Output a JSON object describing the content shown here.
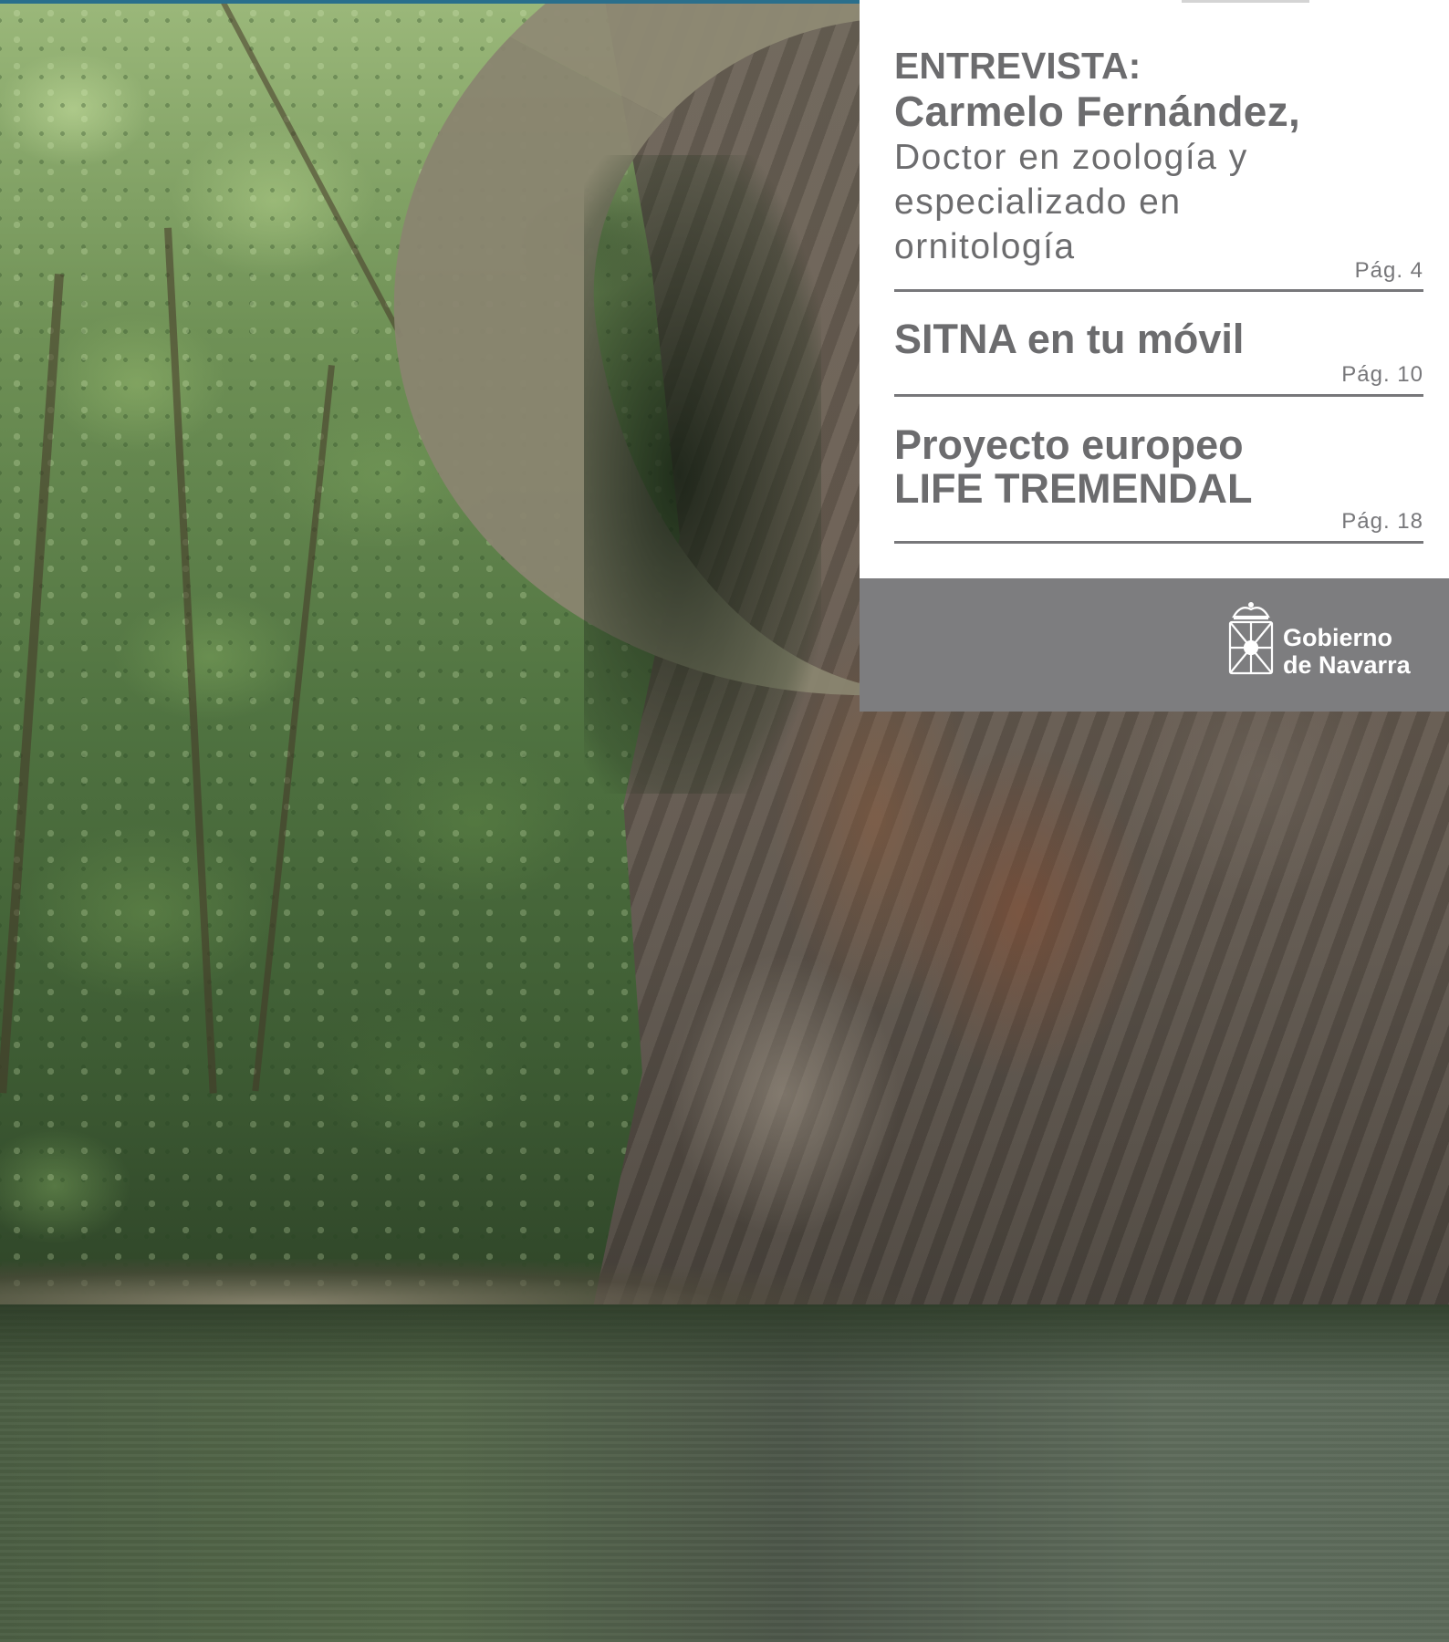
{
  "articles": [
    {
      "kicker": "ENTREVISTA:",
      "title": "Carmelo Fernández,",
      "subtitle_lines": [
        "Doctor en zoología y",
        "especializado en",
        "ornitología"
      ],
      "page": "Pág. 4"
    },
    {
      "title_lines": [
        "SITNA en tu móvil"
      ],
      "page": "Pág. 10"
    },
    {
      "title_lines": [
        "Proyecto europeo",
        "LIFE TREMENDAL"
      ],
      "page": "Pág. 18"
    }
  ],
  "logo": {
    "line1": "Gobierno",
    "line2": "de Navarra"
  },
  "colors": {
    "text_gray": "#6c6c6e",
    "band_gray": "#7d7d7f",
    "panel_white": "#ffffff",
    "top_strip": "#2a6f8c"
  }
}
